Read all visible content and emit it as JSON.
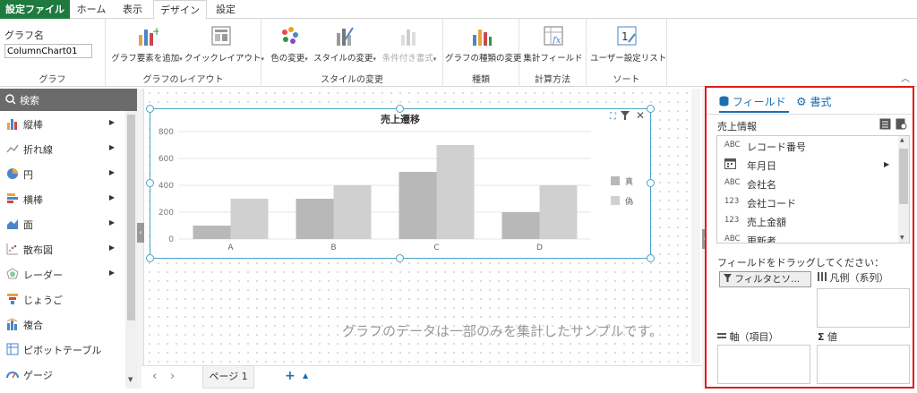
{
  "menu": {
    "file": "設定ファイル",
    "tabs": [
      "ホーム",
      "表示",
      "デザイン",
      "設定"
    ]
  },
  "ribbon": {
    "graph_name_label": "グラフ名",
    "graph_name_value": "ColumnChart01",
    "groups": {
      "graph": "グラフ",
      "layout": "グラフのレイアウト",
      "style": "スタイルの変更",
      "kind": "種類",
      "calc": "計算方法",
      "sort": "ソート"
    },
    "buttons": {
      "add_element": "グラフ要素を追加",
      "quick_layout": "クイックレイアウト",
      "change_color": "色の変更",
      "change_style": "スタイルの変更",
      "conditional_format": "条件付き書式",
      "change_type": "グラフの種類の変更",
      "aggregate_field": "集計フィールド",
      "user_list": "ユーザー設定リスト"
    }
  },
  "left_panel": {
    "search_label": "検索",
    "items": [
      {
        "label": "縦棒",
        "arrow": true
      },
      {
        "label": "折れ線",
        "arrow": true
      },
      {
        "label": "円",
        "arrow": true
      },
      {
        "label": "横棒",
        "arrow": true
      },
      {
        "label": "面",
        "arrow": true
      },
      {
        "label": "散布図",
        "arrow": true
      },
      {
        "label": "レーダー",
        "arrow": true
      },
      {
        "label": "じょうご",
        "arrow": false
      },
      {
        "label": "複合",
        "arrow": false
      },
      {
        "label": "ピボットテーブル",
        "arrow": false
      },
      {
        "label": "ゲージ",
        "arrow": false
      }
    ]
  },
  "canvas": {
    "note": "グラフのデータは一部のみを集計したサンプルです。"
  },
  "chart_data": {
    "type": "bar",
    "title": "売上遷移",
    "categories": [
      "A",
      "B",
      "C",
      "D"
    ],
    "series": [
      {
        "name": "真",
        "values": [
          100,
          300,
          500,
          200
        ],
        "color": "#b8b8b8"
      },
      {
        "name": "偽",
        "values": [
          300,
          400,
          700,
          400
        ],
        "color": "#d0d0d0"
      }
    ],
    "yticks": [
      0,
      200,
      400,
      600,
      800
    ],
    "ylim": [
      0,
      800
    ],
    "grid": true,
    "legend": "right"
  },
  "pagebar": {
    "page_label": "ページ 1"
  },
  "right_panel": {
    "tab_fields": "フィールド",
    "tab_format": "書式",
    "source_label": "売上情報",
    "fields": [
      {
        "type": "ABC",
        "label": "レコード番号",
        "arrow": false
      },
      {
        "type": "calendar",
        "label": "年月日",
        "arrow": true
      },
      {
        "type": "ABC",
        "label": "会社名",
        "arrow": false
      },
      {
        "type": "123",
        "label": "会社コード",
        "arrow": false
      },
      {
        "type": "123",
        "label": "売上金額",
        "arrow": false
      },
      {
        "type": "ABC",
        "label": "更新者",
        "arrow": false
      }
    ],
    "drag_hint": "フィールドをドラッグしてください：",
    "filter_button": "フィルタとソ...",
    "legend_label": "凡例（系列）",
    "axis_label": "軸（項目）",
    "value_label": "値"
  }
}
